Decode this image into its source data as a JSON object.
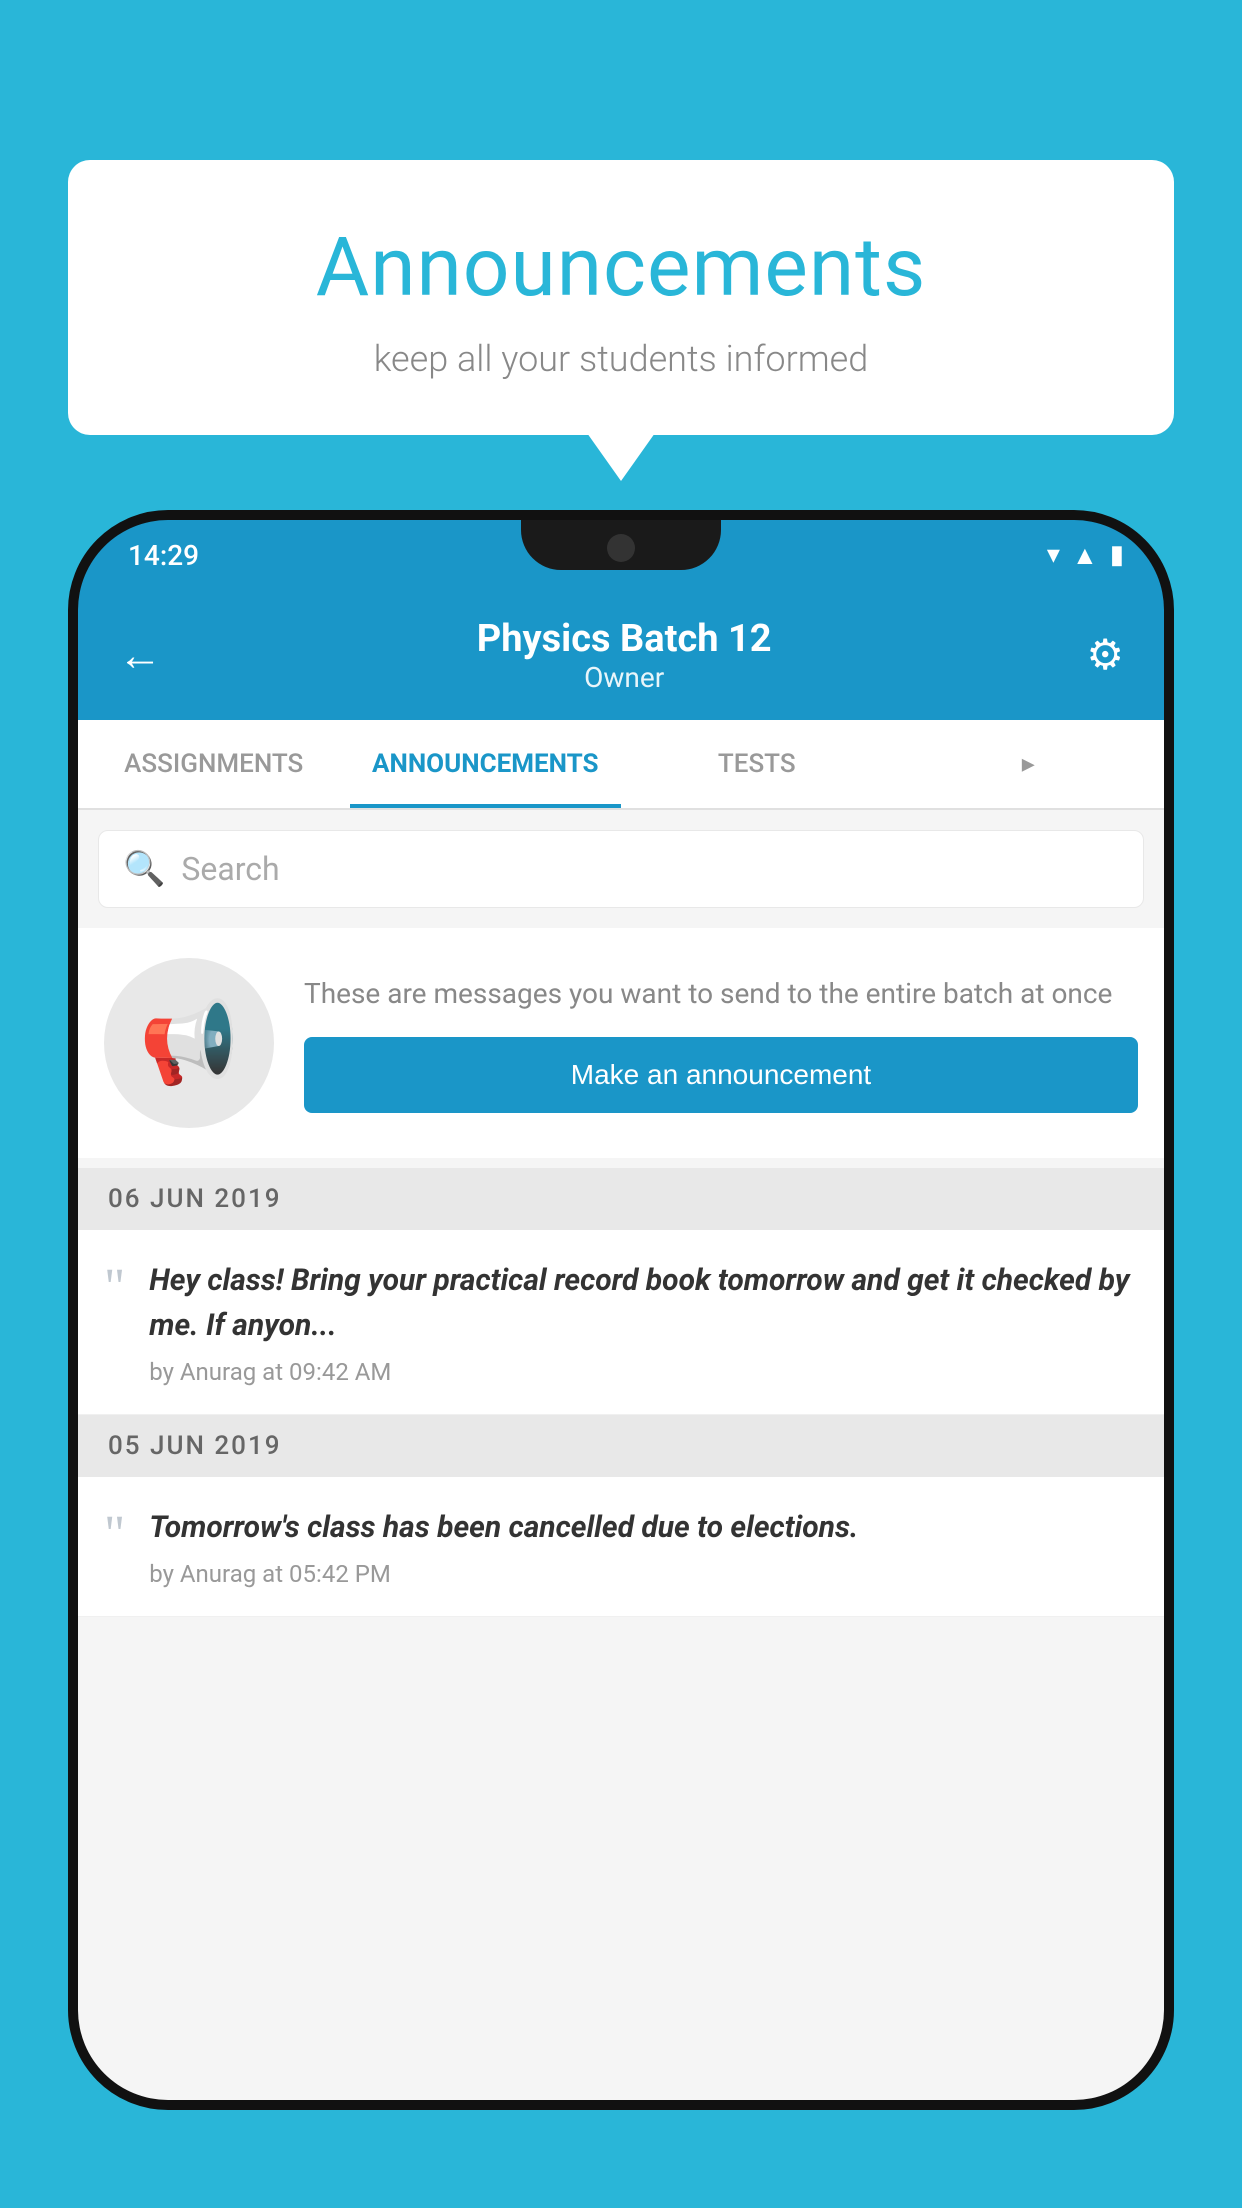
{
  "bubble": {
    "title": "Announcements",
    "subtitle": "keep all your students informed"
  },
  "statusBar": {
    "time": "14:29",
    "wifi": "▾",
    "signal": "▲",
    "battery": "▮"
  },
  "appBar": {
    "back_label": "←",
    "title": "Physics Batch 12",
    "subtitle": "Owner",
    "settings_label": "⚙"
  },
  "tabs": [
    {
      "label": "ASSIGNMENTS",
      "active": false
    },
    {
      "label": "ANNOUNCEMENTS",
      "active": true
    },
    {
      "label": "TESTS",
      "active": false
    },
    {
      "label": "▸",
      "active": false
    }
  ],
  "search": {
    "placeholder": "Search"
  },
  "promoCard": {
    "description": "These are messages you want to send to the entire batch at once",
    "button_label": "Make an announcement"
  },
  "announcements": [
    {
      "date": "06  JUN  2019",
      "items": [
        {
          "body": "Hey class! Bring your practical record book tomorrow and get it checked by me. If anyon...",
          "meta": "by Anurag at 09:42 AM"
        }
      ]
    },
    {
      "date": "05  JUN  2019",
      "items": [
        {
          "body": "Tomorrow's class has been cancelled due to elections.",
          "meta": "by Anurag at 05:42 PM"
        }
      ]
    }
  ],
  "colors": {
    "brand": "#29b6d8",
    "appBar": "#1a96c8",
    "activeTab": "#1a96c8",
    "button": "#1a96c8"
  }
}
